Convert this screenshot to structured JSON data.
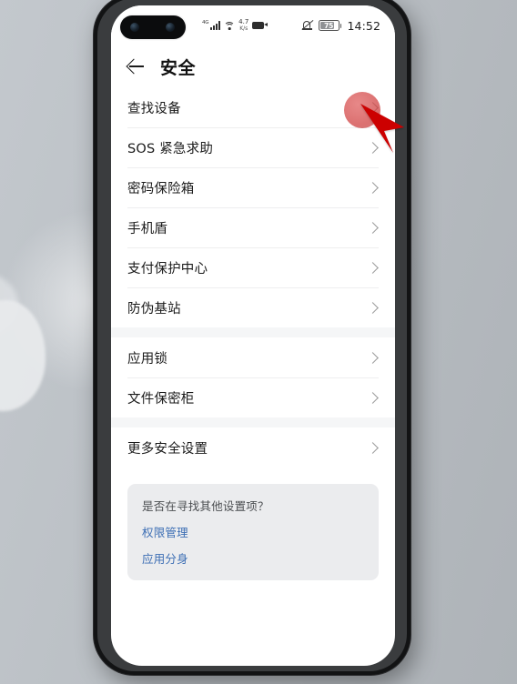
{
  "statusbar": {
    "network_label": "4G",
    "data_rate_value": "4.7",
    "data_rate_unit": "K/s",
    "battery_percent": "75",
    "time": "14:52",
    "icons": [
      "signal-bars-icon",
      "wifi-icon",
      "data-rate-icon",
      "screen-recording-icon",
      "mute-icon",
      "battery-icon"
    ]
  },
  "appbar": {
    "back_label": "back-arrow-icon",
    "title": "安全"
  },
  "groups": [
    {
      "items": [
        {
          "label": "查找设备"
        },
        {
          "label": "SOS 紧急求助"
        },
        {
          "label": "密码保险箱"
        },
        {
          "label": "手机盾"
        },
        {
          "label": "支付保护中心"
        },
        {
          "label": "防伪基站"
        }
      ]
    },
    {
      "items": [
        {
          "label": "应用锁"
        },
        {
          "label": "文件保密柜"
        }
      ]
    },
    {
      "items": [
        {
          "label": "更多安全设置"
        }
      ]
    }
  ],
  "suggestion_card": {
    "question": "是否在寻找其他设置项？",
    "links": [
      {
        "label": "权限管理"
      },
      {
        "label": "应用分身"
      }
    ]
  },
  "colors": {
    "link_blue": "#3c6eb4",
    "cursor_red": "#cc0000",
    "card_bg": "#ebecee",
    "divider": "#eeeeef",
    "section_gap": "#f5f6f7"
  }
}
